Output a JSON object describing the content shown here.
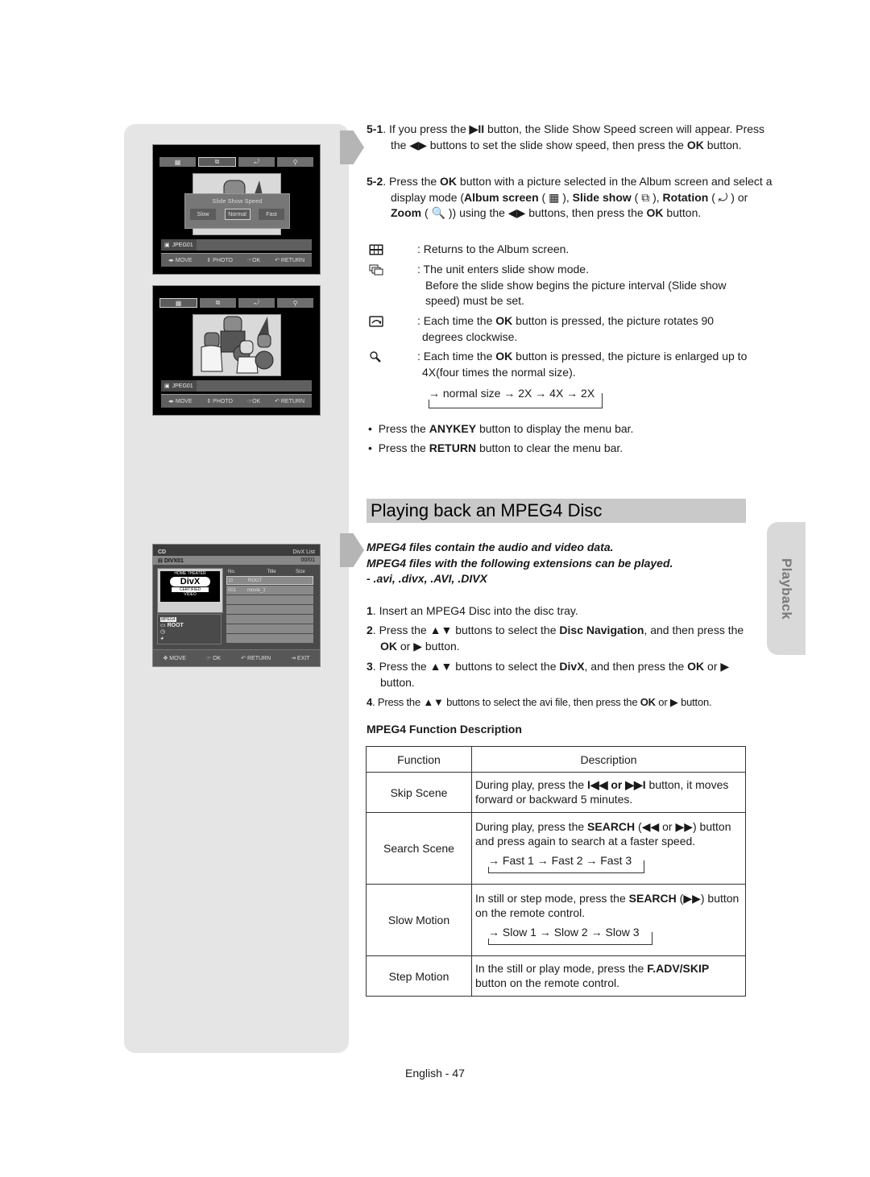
{
  "sidebar": {
    "screen1": {
      "tabs": [
        "album-icon",
        "slideshow-icon",
        "rotation-icon",
        "zoom-icon"
      ],
      "dialog_title": "Slide Show Speed",
      "dialog_options": [
        "Slow",
        "Normal",
        "Fast"
      ],
      "dialog_selected": "Normal",
      "file_name": "JPEG01",
      "nav": [
        "◂▸ MOVE",
        "⇕ PHOTO",
        "☞OK",
        "↶ RETURN"
      ]
    },
    "screen2": {
      "tabs": [
        "album-icon",
        "slideshow-icon",
        "rotation-icon",
        "zoom-icon"
      ],
      "file_name": "JPEG01",
      "nav": [
        "◂▸ MOVE",
        "⇕ PHOTO",
        "☞OK",
        "↶ RETURN"
      ]
    },
    "screen3": {
      "source": "CD",
      "title": "DivX List",
      "folder": "DIVX01",
      "counter": "00/01",
      "logo_top": "HOME THEATER",
      "logo_main": "DivX",
      "logo_sub": "CERTIFIED",
      "logo_bottom": "VIDEO",
      "format_badge": "MPEG4",
      "current_folder": "ROOT",
      "columns": [
        "No.",
        "Title",
        "Size"
      ],
      "rows": [
        {
          "no": "",
          "title": "ROOT",
          "size": ""
        },
        {
          "no": "001",
          "title": "movie_1",
          "size": ""
        }
      ],
      "nav": [
        "✥ MOVE",
        "☞ OK",
        "↶ RETURN",
        "⇥ EXIT"
      ]
    }
  },
  "steps_top": {
    "s51": {
      "num": "5-1",
      "text_a": ". If you press the ",
      "sym": "▶II",
      "text_b": " button, the Slide Show Speed screen will appear. Press the ◀▶ buttons to set the slide show speed, then press the ",
      "ok": "OK",
      "text_c": " button."
    },
    "s52": {
      "num": "5-2",
      "t1": ". Press the ",
      "ok": "OK",
      "t2": " button with a picture selected in the Album screen and select a display mode (",
      "album": "Album screen",
      "t3": " ( ▦ ), ",
      "slide": "Slide show",
      "t4": " ( ⧉ ), ",
      "rot": "Rotation",
      "t5": " ( ⤾ ) or ",
      "zoom": "Zoom",
      "t6": " ( 🔍 )) using the ◀▶ buttons, then press the ",
      "ok2": "OK",
      "t7": " button."
    }
  },
  "icon_descriptions": [
    {
      "icon": "album-grid-icon",
      "text": ": Returns to the Album screen."
    },
    {
      "icon": "slideshow-icon",
      "text": ": The unit enters slide show mode.",
      "text2": "Before the slide show begins the picture interval (Slide show speed) must be set."
    },
    {
      "icon": "rotation-icon",
      "pre": ": Each time the ",
      "bold": "OK",
      "post": " button is pressed, the picture rotates 90 degrees clockwise."
    },
    {
      "icon": "zoom-icon",
      "pre": ": Each time the ",
      "bold": "OK",
      "post": " button is pressed, the picture is enlarged up to 4X(four times the normal size)."
    }
  ],
  "zoom_cycle": "→ normal size → 2X → 4X → 2X",
  "bullets": [
    {
      "pre": "Press the ",
      "bold": "ANYKEY",
      "post": " button to display the menu bar."
    },
    {
      "pre": "Press the ",
      "bold": "RETURN",
      "post": " button to clear the menu bar."
    }
  ],
  "section": {
    "title": "Playing back an MPEG4 Disc",
    "intro": [
      "MPEG4 files contain the audio and video data.",
      "MPEG4 files with the following extensions can be played.",
      "- .avi, .divx, .AVI, .DIVX"
    ],
    "steps": [
      {
        "num": "1",
        "pre": ". Insert an MPEG4 Disc into the disc tray."
      },
      {
        "num": "2",
        "pre": ". Press the ▲▼ buttons to select the ",
        "b1": "Disc Navigation",
        "mid": ", and then press the ",
        "b2": "OK",
        "post": " or ▶ button."
      },
      {
        "num": "3",
        "pre": ". Press the ▲▼ buttons to select the ",
        "b1": "DivX",
        "mid": ", and then press the ",
        "b2": "OK",
        "post": " or ▶ button."
      },
      {
        "num": "4",
        "pre": ". Press the ▲▼ buttons to select the avi file, then press the ",
        "b2": "OK",
        "post": " or ▶ button."
      }
    ],
    "table_title": "MPEG4 Function Description",
    "table": {
      "headers": [
        "Function",
        "Description"
      ],
      "rows": [
        {
          "function": "Skip Scene",
          "pre": "During play, press the ",
          "sym": "I◀◀ or ▶▶I",
          "post": " button, it moves forward or backward 5 minutes."
        },
        {
          "function": "Search Scene",
          "pre": "During play, press the ",
          "bold": "SEARCH",
          "post": " (◀◀ or ▶▶) button and press again to search at a faster speed.",
          "cycle": "→ Fast 1 → Fast 2 → Fast 3"
        },
        {
          "function": "Slow Motion",
          "pre": "In still or step mode, press the ",
          "bold": "SEARCH",
          "post": " (▶▶) button on the remote control.",
          "cycle": "→ Slow 1 → Slow 2 → Slow 3"
        },
        {
          "function": "Step Motion",
          "pre": "In the still or play mode, press the ",
          "bold": "F.ADV/SKIP",
          "post": " button on the remote control."
        }
      ]
    }
  },
  "side_tab": "Playback",
  "footer": "English - 47"
}
